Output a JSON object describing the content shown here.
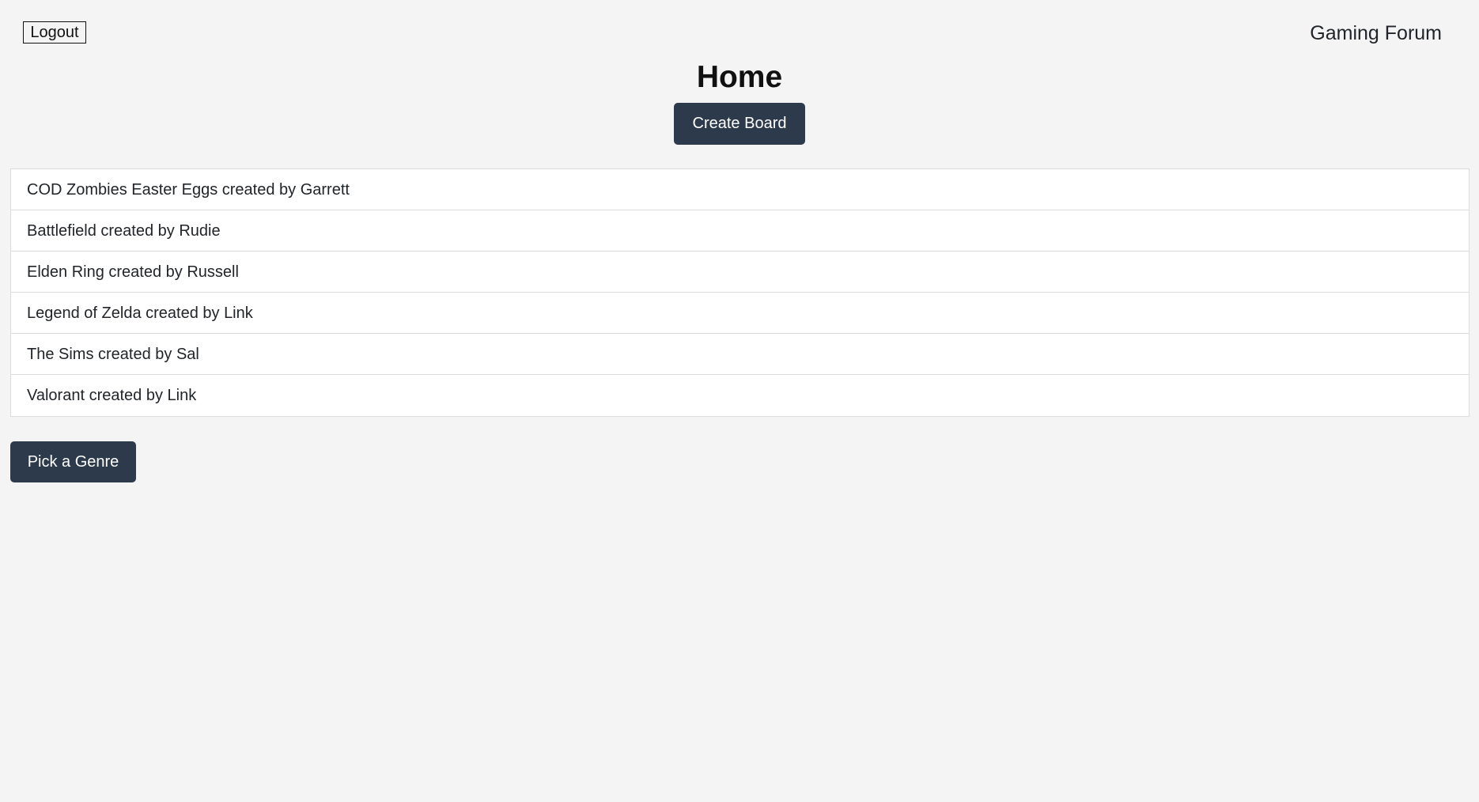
{
  "header": {
    "logout_label": "Logout",
    "site_title": "Gaming Forum"
  },
  "main": {
    "title": "Home",
    "create_board_label": "Create Board",
    "boards": [
      {
        "label": "COD Zombies Easter Eggs created by Garrett"
      },
      {
        "label": "Battlefield created by Rudie"
      },
      {
        "label": "Elden Ring created by Russell"
      },
      {
        "label": "Legend of Zelda created by Link"
      },
      {
        "label": "The Sims created by Sal"
      },
      {
        "label": "Valorant created by Link"
      }
    ],
    "pick_genre_label": "Pick a Genre"
  },
  "colors": {
    "background": "#f4f4f4",
    "button_dark": "#2d3a4b",
    "list_background": "#ffffff",
    "list_border": "#dcdcdc"
  }
}
